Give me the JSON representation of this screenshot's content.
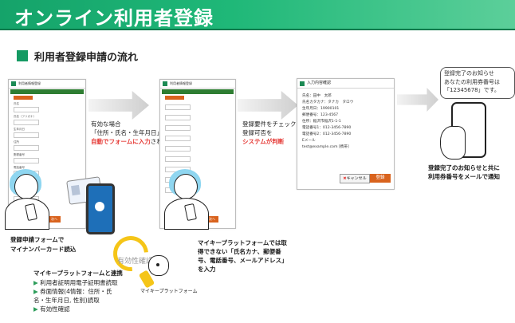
{
  "header": {
    "title": "オンライン利用者登録"
  },
  "section": {
    "title": "利用者登録申請の流れ"
  },
  "screen1": {
    "head_title": "利用者情報登録",
    "button_label": "次へ",
    "fields": [
      "氏名",
      "氏名（フリガナ）",
      "生年月日",
      "住所",
      "郵便番号",
      "電話番号",
      "メールアドレス",
      "パスワード"
    ]
  },
  "screen2": {
    "head_title": "利用者情報登録",
    "button_label": "次へ"
  },
  "arrow1_text": {
    "l1": "有効な場合",
    "l2": "「住所・氏名・生年月日」が",
    "l3_red": "自動でフォームに入力",
    "l3_rest": "される"
  },
  "arrow2_text": {
    "l1": "登録要件をチェックし、",
    "l2": "登録可否を",
    "l3_red": "システムが判断"
  },
  "confirm": {
    "head_title": "入力内容確認",
    "rows": [
      "氏名：田中　太郎",
      "氏名カタカナ：タナカ　タロウ",
      "生年月日：19900101",
      "郵便番号：123-4567",
      "住所：稲沢市稲沢1-1-1",
      "電話番号1：012-3456-7890",
      "電話番号2：012-3456-7890",
      "Eメール",
      "test@example.com [携帯]"
    ],
    "cancel_label": "キャンセル",
    "register_label": "登録"
  },
  "notice": {
    "l1": "登録完了のお知らせ",
    "l2": "あなたの利用券番号は",
    "l3": "「12345678」です。"
  },
  "captions": {
    "read_l1": "登録申請フォームで",
    "read_l2": "マイナンバーカード読込",
    "platform_l1": "マイキープラットフォームでは取",
    "platform_l2": "得できない「氏名カナ、郵便番",
    "platform_l3": "号、電話番号、メールアドレス」",
    "platform_l4": "を入力",
    "done_l1": "登録完了のお知らせと共に",
    "done_l2": "利用券番号をメールで通知"
  },
  "validity_label": "有効性確認",
  "mascot_label": "マイキープラットフォーム",
  "linkage": {
    "title": "マイキープラットフォームと連携",
    "items": [
      "利用者証明用電子証明書読取",
      "券面情報(4情報：住所・氏",
      "名・生年月日, 性別)読取",
      "有効性確認"
    ]
  },
  "colors": {
    "header_green": "#1fb878",
    "accent_red": "#e53935",
    "bullet_green": "#2e9e5b",
    "button_orange": "#d9631e",
    "mascot_yellow": "#f5c518"
  }
}
